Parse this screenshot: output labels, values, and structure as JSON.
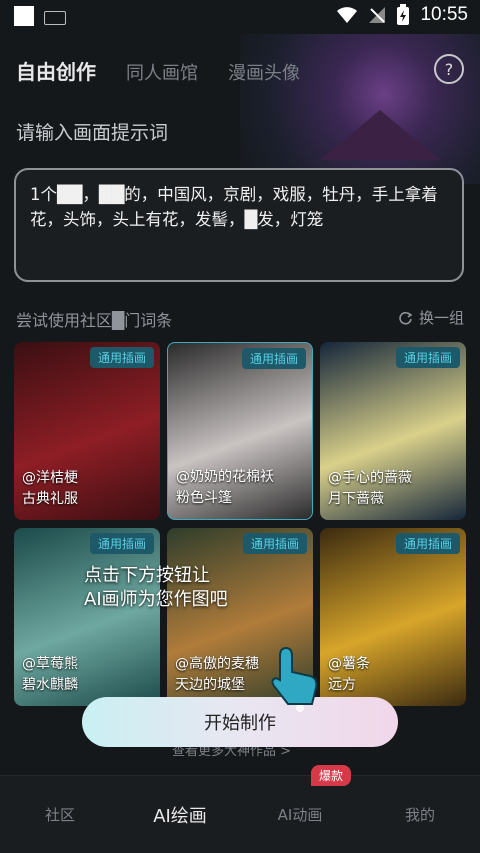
{
  "status_bar": {
    "time": "10:55"
  },
  "header": {
    "tabs": [
      {
        "label": "自由创作",
        "active": true
      },
      {
        "label": "同人画馆",
        "active": false
      },
      {
        "label": "漫画头像",
        "active": false
      }
    ],
    "help": "?"
  },
  "prompt": {
    "label": "请输入画面提示词",
    "text": "1个██，██的，中国风，京剧，戏服，牡丹，手上拿着花，头饰，头上有花，发髻，█发，灯笼"
  },
  "suggestions": {
    "label": "尝试使用社区█门词条",
    "refresh": "换一组",
    "cards": [
      {
        "tag": "通用插画",
        "author": "@洋桔梗",
        "title": "古典礼服",
        "colors": [
          "#3a0f12",
          "#8e1e25"
        ]
      },
      {
        "tag": "通用插画",
        "author": "@奶奶的花棉袄",
        "title": "粉色斗篷",
        "colors": [
          "#2b2b2b",
          "#c9c3c2"
        ]
      },
      {
        "tag": "通用插画",
        "author": "@手心的蔷薇",
        "title": "月下蔷薇",
        "colors": [
          "#15263a",
          "#d9d08a"
        ]
      },
      {
        "tag": "通用插画",
        "author": "@草莓熊",
        "title": "碧水麒麟",
        "colors": [
          "#1b4a4a",
          "#6fa8a0"
        ]
      },
      {
        "tag": "通用插画",
        "author": "@高傲的麦穗",
        "title": "天边的城堡",
        "colors": [
          "#2e3d2b",
          "#b07c3a"
        ]
      },
      {
        "tag": "通用插画",
        "author": "@薯条",
        "title": "远方",
        "colors": [
          "#3b2a10",
          "#d7a52a"
        ]
      }
    ]
  },
  "tip": {
    "line1": "点击下方按钮让",
    "line2": "AI画师为您作图吧"
  },
  "start_button": "开始制作",
  "more_link": "查看更多大神作品 >",
  "bottom_nav": {
    "items": [
      {
        "label": "社区",
        "active": false
      },
      {
        "label": "AI绘画",
        "active": true
      },
      {
        "label": "AI动画",
        "active": false
      },
      {
        "label": "我的",
        "active": false
      }
    ],
    "badge": "爆款"
  }
}
